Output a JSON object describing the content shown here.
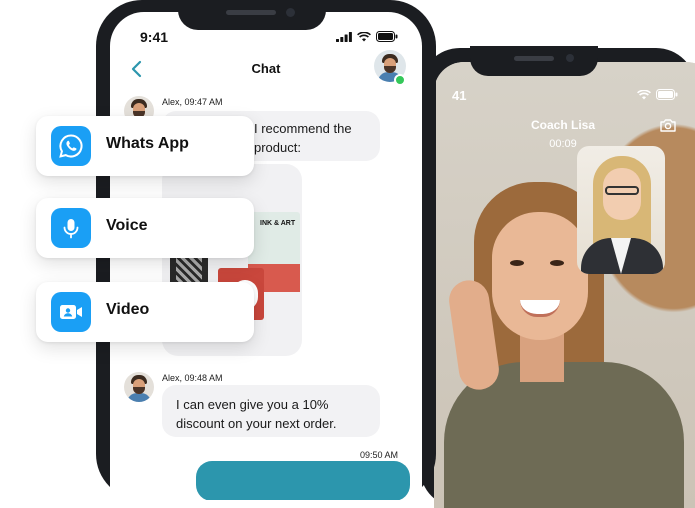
{
  "chat_phone": {
    "status_time": "9:41",
    "header_title": "Chat",
    "messages": [
      {
        "sender": "Alex, 09:47 AM",
        "text_line1": "I recommend the",
        "text_line2": "product:"
      },
      {
        "sender": "Alex, 09:48 AM",
        "text_line1": "I can even give you a 10%",
        "text_line2": "discount on your next order."
      }
    ],
    "product_box_label": "INK & ART",
    "outgoing_time": "09:50 AM"
  },
  "video_phone": {
    "status_time": "41",
    "caller_name": "Coach Lisa",
    "call_timer": "00:09"
  },
  "options": [
    {
      "label": "Whats App",
      "icon": "whatsapp-icon"
    },
    {
      "label": "Voice",
      "icon": "microphone-icon"
    },
    {
      "label": "Video",
      "icon": "video-camera-icon"
    }
  ],
  "colors": {
    "accent_blue": "#1a9ff5",
    "outgoing_bubble": "#2c96ad",
    "back_arrow": "#2c96ad",
    "online_dot": "#34c759"
  }
}
